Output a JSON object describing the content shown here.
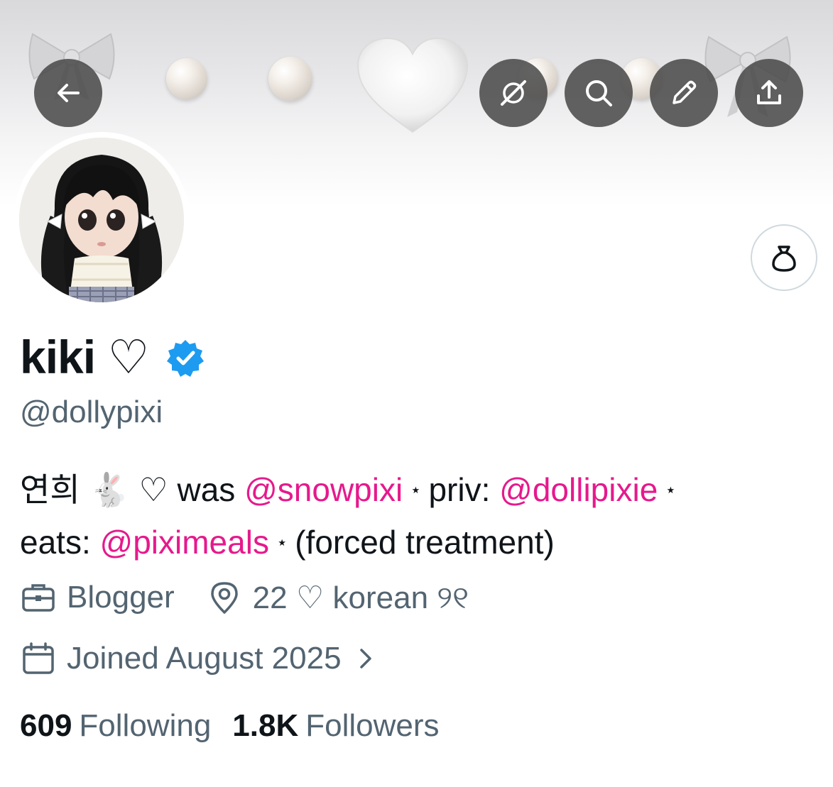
{
  "colors": {
    "accent_mention": "#e6198c",
    "secondary_text": "#536471",
    "verified_blue": "#1d9bf0",
    "button_overlay": "#484848"
  },
  "header": {
    "back_icon": "arrow-left-icon",
    "buttons": [
      {
        "icon": "grok-slash-icon"
      },
      {
        "icon": "search-icon"
      },
      {
        "icon": "pencil-icon"
      },
      {
        "icon": "share-upload-icon"
      }
    ]
  },
  "profile": {
    "display_name": "kiki ♡",
    "verified": true,
    "handle": "@dollypixi",
    "tip_button_icon": "money-bag-icon",
    "bio": {
      "prefix": "연희 🐇 ♡ was ",
      "mention_1": "@snowpixi",
      "sep_1": "⋆",
      "text_2": "priv: ",
      "mention_2": "@dollipixie",
      "sep_2": "⋆",
      "text_3": "eats: ",
      "mention_3": "@piximeals",
      "sep_3": "⋆",
      "text_4": "(forced treatment)"
    },
    "profession": "Blogger",
    "location": "22 ♡ korean ୨୧",
    "joined": "Joined August 2025",
    "following_count": "609",
    "following_label": "Following",
    "followers_count": "1.8K",
    "followers_label": "Followers"
  }
}
